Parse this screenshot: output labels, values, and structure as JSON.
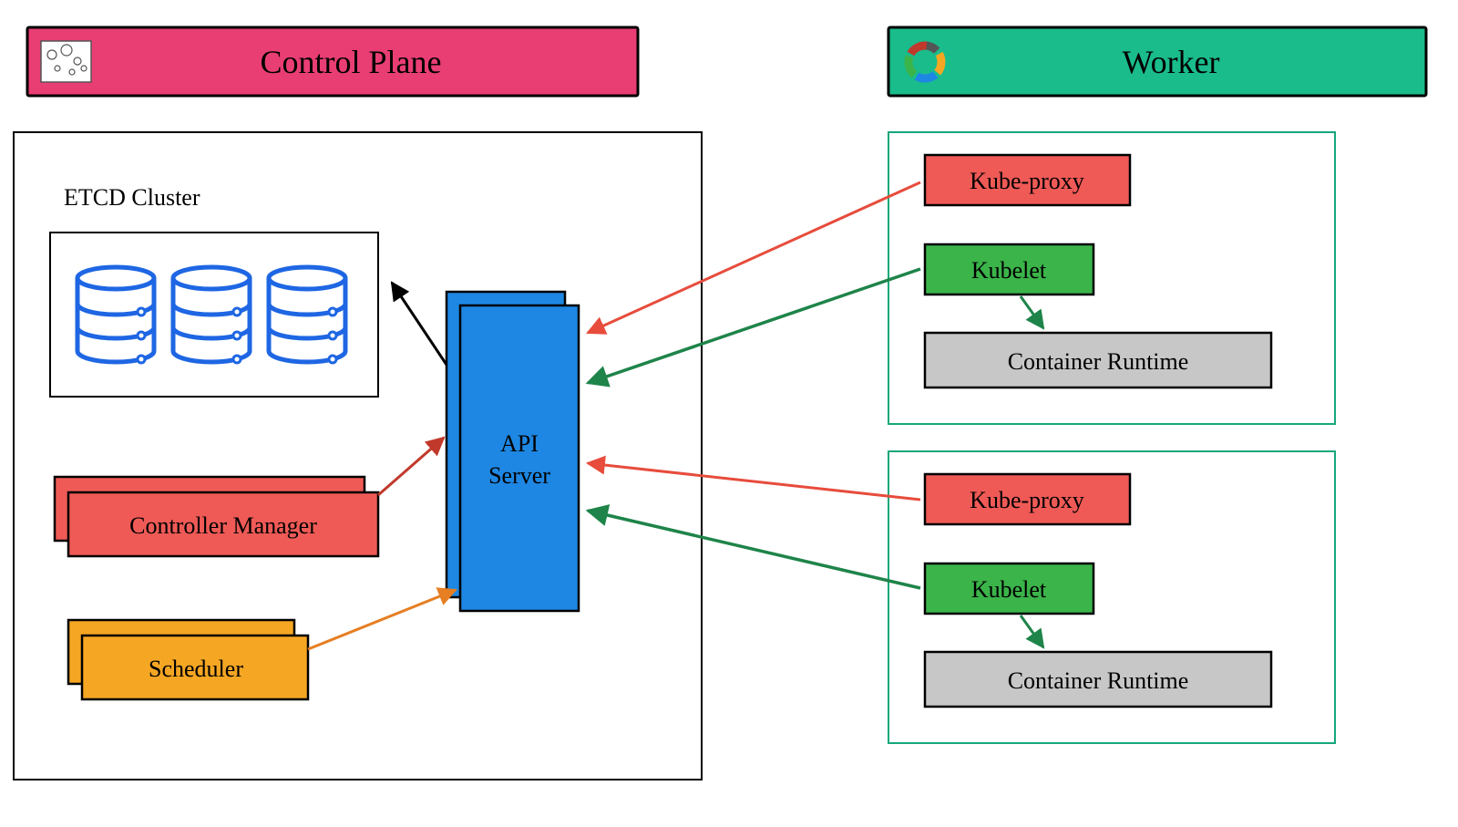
{
  "controlPlane": {
    "headerLabel": "Control Plane",
    "etcdCluster": "ETCD Cluster",
    "apiServer": {
      "l1": "API",
      "l2": "Server"
    },
    "controllerManager": "Controller Manager",
    "scheduler": "Scheduler"
  },
  "worker": {
    "headerLabel": "Worker",
    "nodes": [
      {
        "kubeProxy": "Kube-proxy",
        "kubelet": "Kubelet",
        "runtime": "Container Runtime"
      },
      {
        "kubeProxy": "Kube-proxy",
        "kubelet": "Kubelet",
        "runtime": "Container Runtime"
      }
    ]
  },
  "colors": {
    "pink": "#e83e73",
    "teal": "#1abc8c",
    "red": "#ef5a56",
    "orange": "#f5a623",
    "blue": "#1e87e3",
    "green": "#3bb44a",
    "grey": "#c7c7c7",
    "darkRed": "#c0392b",
    "workerBorder": "#15a77b"
  }
}
